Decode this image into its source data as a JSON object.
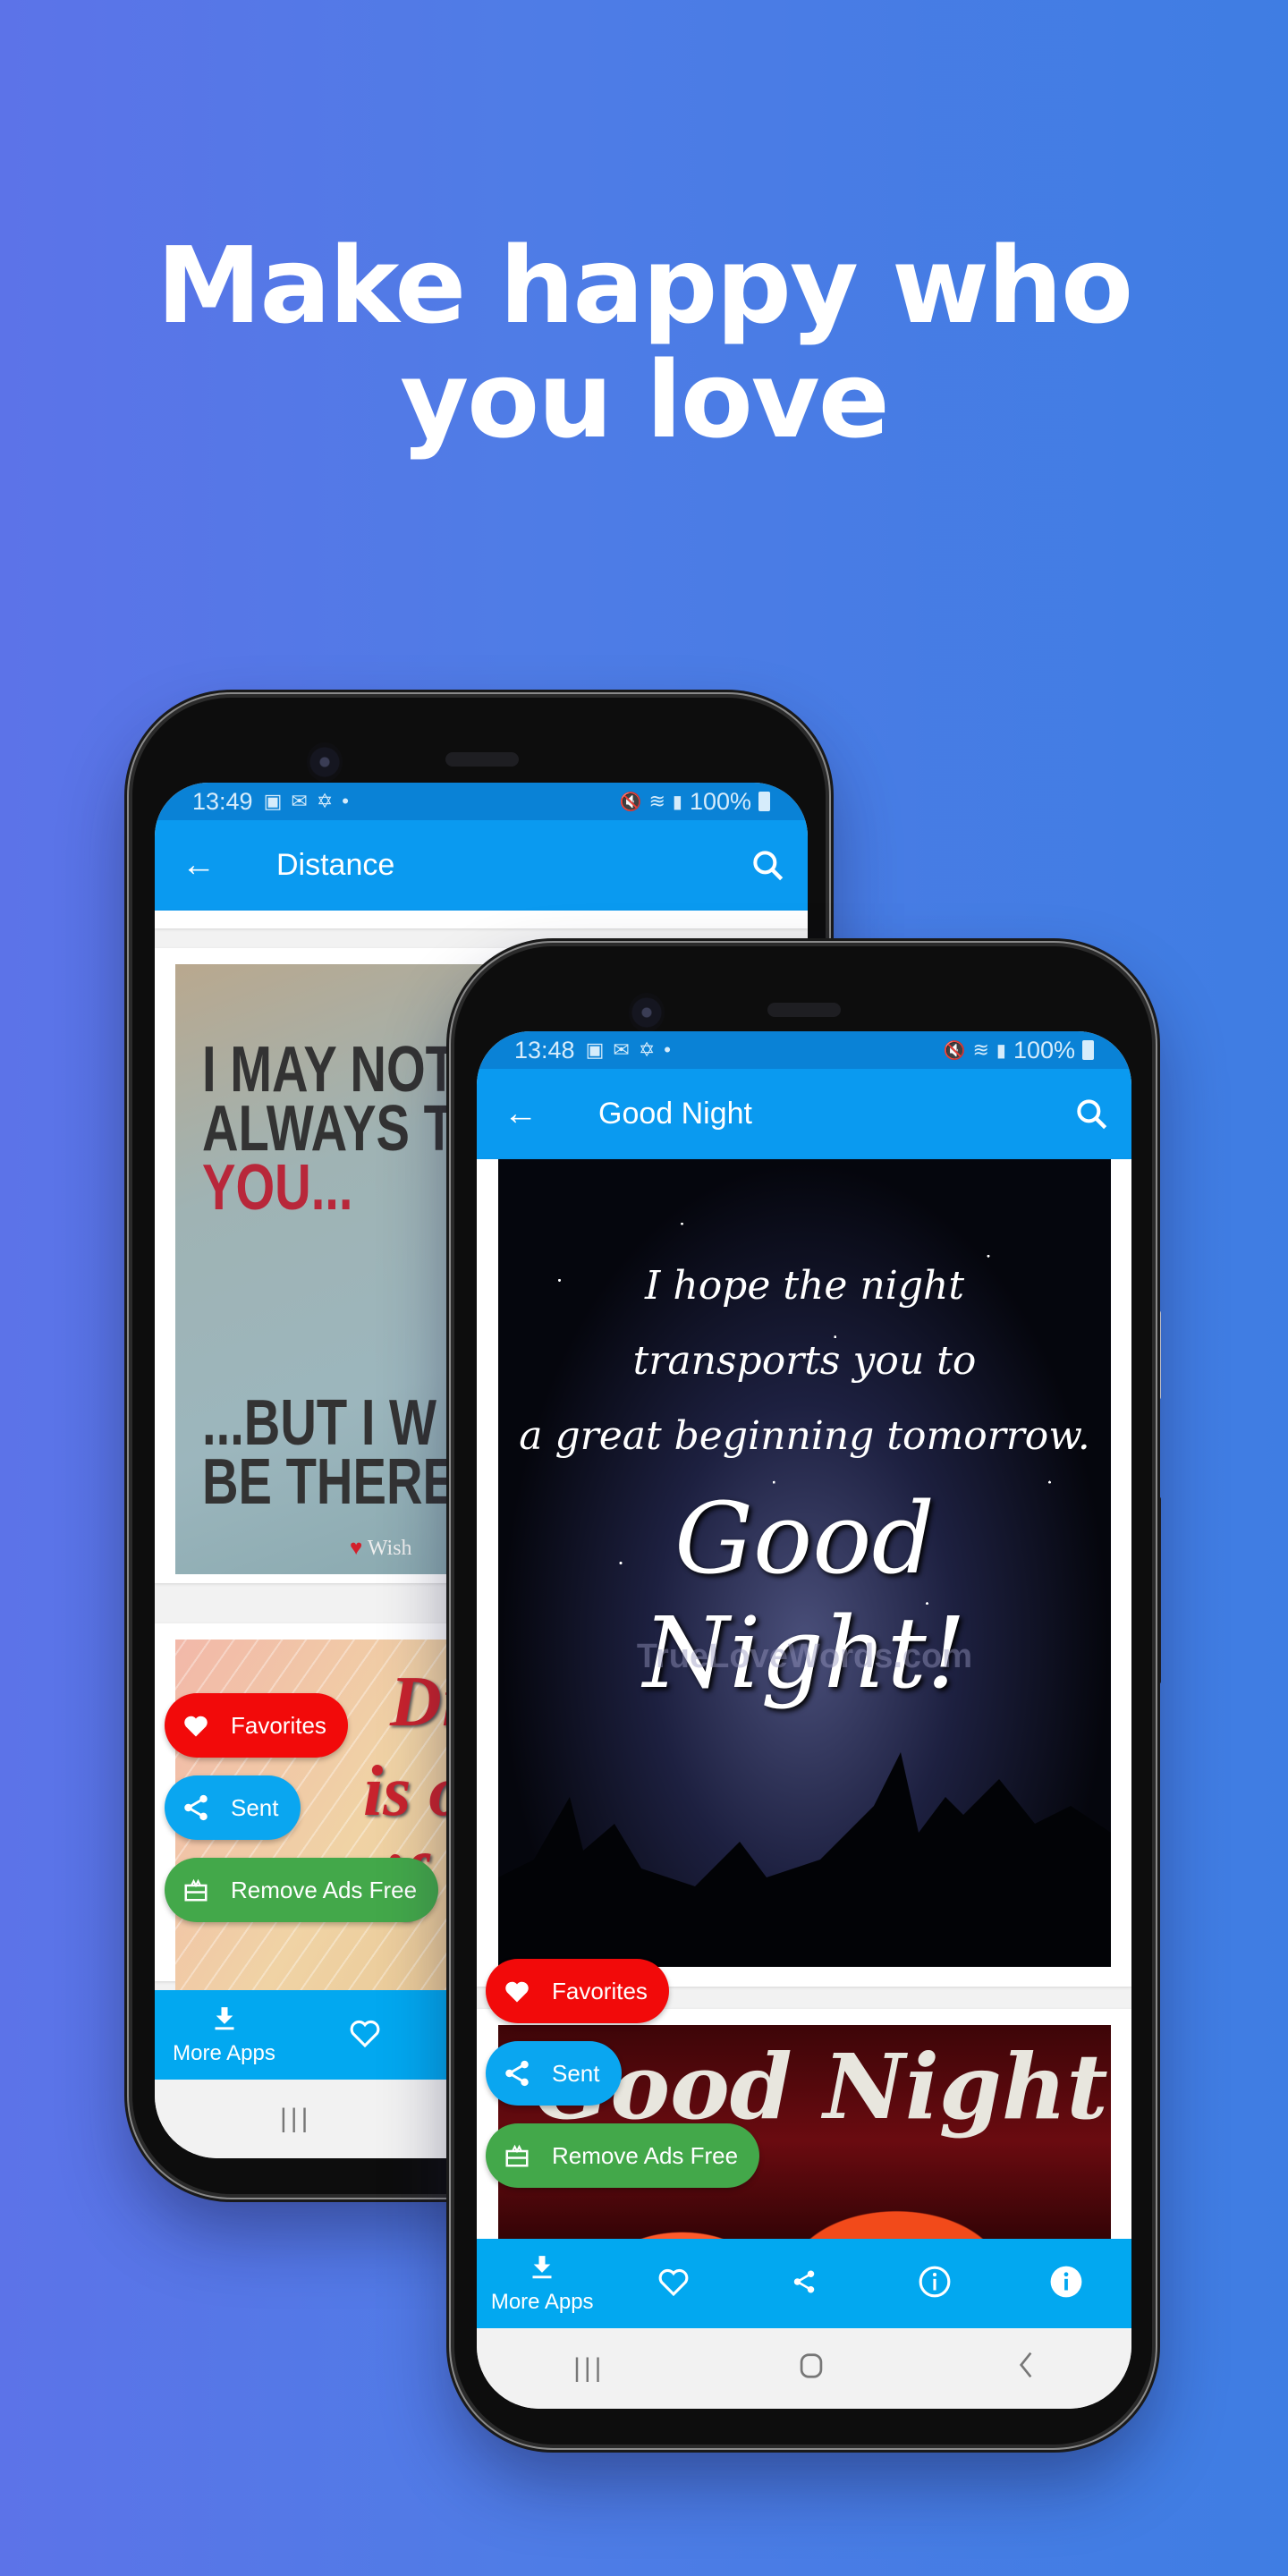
{
  "headline": {
    "line1": "Make happy who",
    "line2": "you love"
  },
  "colors": {
    "background_left": "#5c73e8",
    "background_right": "#3f7de3",
    "status_bar": "#0a82d6",
    "app_bar": "#0a9af0",
    "bottom_nav": "#02a8f0",
    "favorites": "#f20a0a",
    "sent": "#0aa6f0",
    "remove_ads": "#43a84a"
  },
  "back_phone": {
    "status": {
      "time": "13:49",
      "icons": [
        "gallery-icon",
        "mail-icon",
        "pinwheel-icon",
        "dot-icon"
      ],
      "right_icons": [
        "mute-icon",
        "wifi-icon",
        "signal-icon"
      ],
      "battery": "100%"
    },
    "app_bar": {
      "back_icon": "arrow-left-icon",
      "title": "Distance",
      "search_icon": "search-icon"
    },
    "cards": [
      {
        "image_text_lines": [
          "I MAY NOT",
          "ALWAYS T",
          "YOU...",
          "...BUT I W",
          "BE THERE"
        ],
        "watermark": "Wish"
      },
      {
        "image_text_lines": [
          "Dis",
          "is onl",
          "if"
        ]
      }
    ],
    "fabs": [
      {
        "label": "Favorites",
        "icon": "heart-icon"
      },
      {
        "label": "Sent",
        "icon": "share-icon"
      },
      {
        "label": "Remove Ads Free",
        "icon": "gift-icon"
      }
    ],
    "bottom_nav": [
      {
        "label": "More Apps",
        "icon": "download-icon"
      },
      {
        "label": "",
        "icon": "heart-outline-icon"
      }
    ],
    "system_nav": [
      "recents-icon"
    ]
  },
  "front_phone": {
    "status": {
      "time": "13:48",
      "icons": [
        "gallery-icon",
        "mail-icon",
        "pinwheel-icon",
        "dot-icon"
      ],
      "right_icons": [
        "mute-icon",
        "wifi-icon",
        "signal-icon"
      ],
      "battery": "100%"
    },
    "app_bar": {
      "back_icon": "arrow-left-icon",
      "title": "Good Night",
      "search_icon": "search-icon"
    },
    "cards": [
      {
        "image_text_lines": [
          "I hope the night",
          "transports you to",
          "a great beginning tomorrow."
        ],
        "image_title": "Good Night!",
        "watermark": "TrueLoveWords.com"
      },
      {
        "image_title": "Good Night"
      }
    ],
    "fabs": [
      {
        "label": "Favorites",
        "icon": "heart-icon"
      },
      {
        "label": "Sent",
        "icon": "share-icon"
      },
      {
        "label": "Remove Ads Free",
        "icon": "gift-icon"
      }
    ],
    "bottom_nav": [
      {
        "label": "More Apps",
        "icon": "download-icon"
      },
      {
        "label": "",
        "icon": "heart-outline-icon"
      },
      {
        "label": "",
        "icon": "share-icon"
      },
      {
        "label": "",
        "icon": "info-outline-icon"
      },
      {
        "label": "",
        "icon": "info-filled-icon"
      }
    ],
    "system_nav": [
      "recents-icon",
      "home-icon",
      "back-icon"
    ]
  }
}
